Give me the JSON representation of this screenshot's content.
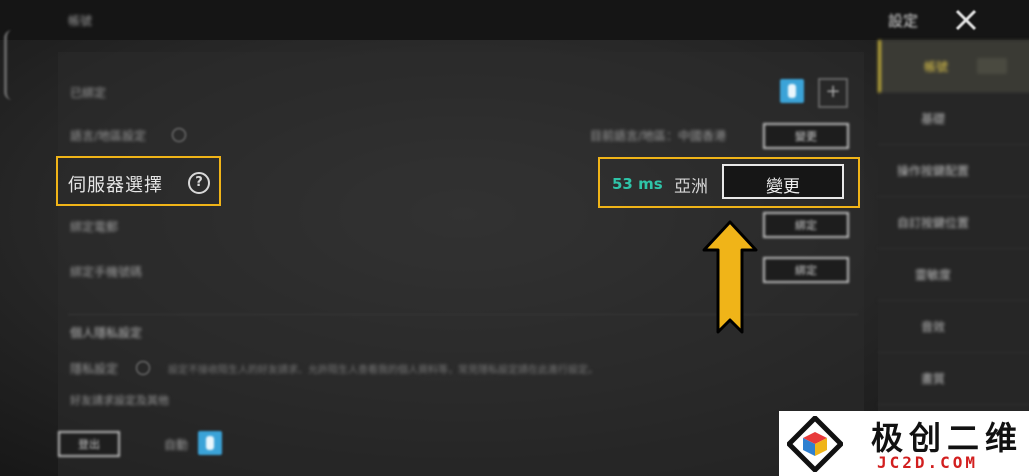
{
  "window": {
    "title": "帳號",
    "settings_title": "設定",
    "close_icon": "close-icon"
  },
  "sidebar": {
    "items": [
      {
        "label": "帳號",
        "badge": "",
        "active": true
      },
      {
        "label": "基礎"
      },
      {
        "label": "操作按鍵配置"
      },
      {
        "label": "自訂按鍵位置"
      },
      {
        "label": "靈敏度"
      },
      {
        "label": "音效"
      },
      {
        "label": "畫質"
      }
    ]
  },
  "rows": {
    "bind_label": "已綁定",
    "region_setting_label": "語言/地區設定",
    "region_setting_value": "目前語言/地區：中國香港",
    "region_setting_button": "變更",
    "phone_label": "綁定電郵",
    "phone_button": "綁定",
    "mobile_label": "綁定手機號碼",
    "mobile_button": "綁定",
    "privacy_title": "個人隱私設定",
    "privacy_label": "隱私設定",
    "privacy_desc": "設定不接收陌生人的好友請求、允許陌生人查看我的個人資料等，常見隱私設定請在此進行設定。",
    "other_label": "好友請求設定及其他"
  },
  "server": {
    "label": "伺服器選擇",
    "help_icon": "?",
    "ping": "53 ms",
    "region": "亞洲",
    "change_label": "變更"
  },
  "bottom": {
    "button": "登出",
    "toggle_label": "自動"
  },
  "watermark": {
    "title": "极创二维",
    "url": "JC2D.COM"
  },
  "colors": {
    "highlight": "#f0b418",
    "ping": "#2fc4a8",
    "toggle": "#3ba3d8"
  }
}
